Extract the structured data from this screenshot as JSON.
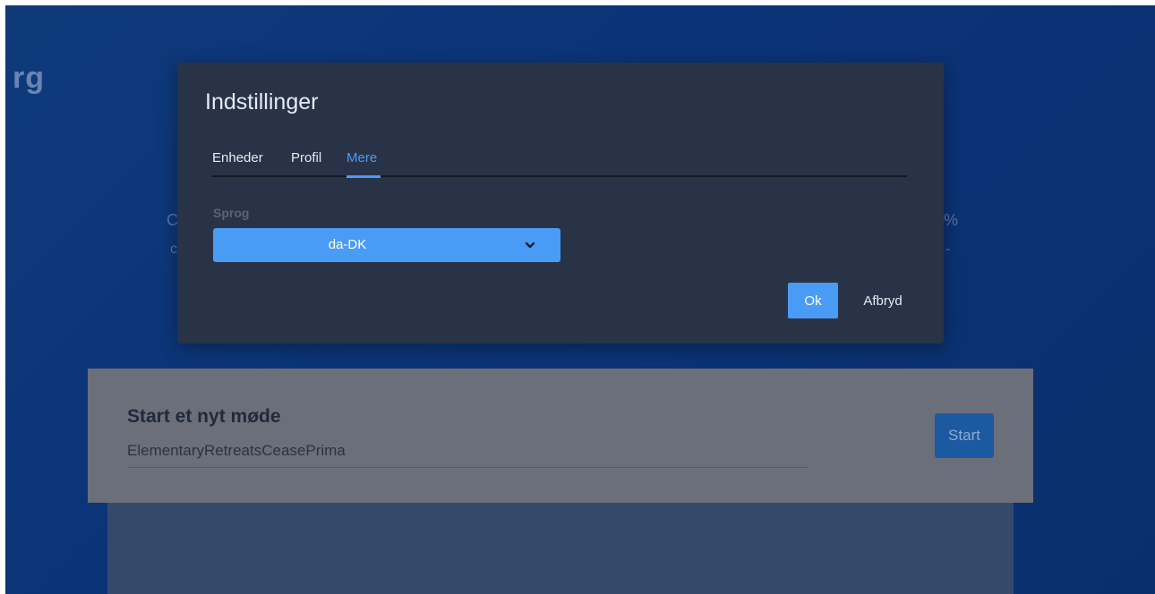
{
  "background": {
    "brand_fragment": "rg",
    "left_fragment_1": "C",
    "left_fragment_2": "c",
    "right_fragment_1": "%",
    "right_fragment_2": "-"
  },
  "meeting": {
    "title": "Start et nyt møde",
    "room_name": "ElementaryRetreatsCeasePrima",
    "start_label": "Start"
  },
  "dialog": {
    "title": "Indstillinger",
    "tabs": [
      {
        "label": "Enheder"
      },
      {
        "label": "Profil"
      },
      {
        "label": "Mere"
      }
    ],
    "active_tab": "Mere",
    "language_label": "Sprog",
    "language_value": "da-DK",
    "ok_label": "Ok",
    "cancel_label": "Afbryd"
  },
  "colors": {
    "accent": "#4a9bf5",
    "dialog_bg": "#283347",
    "page_bg": "#0b3478"
  }
}
